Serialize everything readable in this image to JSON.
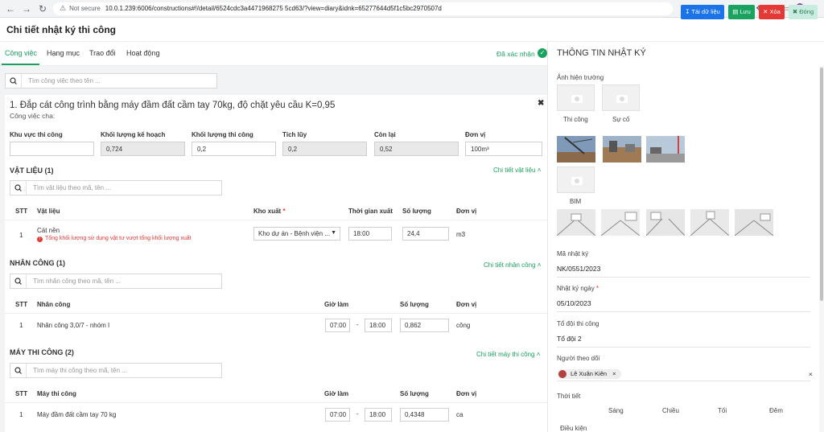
{
  "browser": {
    "not_secure": "Not secure",
    "url": "10.0.1.239:6006/constructions#!/detail/6524cdc3a4471968275 5cd63/?view=diary&idnk=65277644d5f1c5bc2970507d",
    "profile_initial": "A"
  },
  "header": {
    "title": "Chi tiết nhật ký thi công",
    "download": "Tải dữ liệu",
    "save": "Lưu",
    "delete": "Xóa",
    "close": "Đóng"
  },
  "tabs": [
    "Công việc",
    "Hạng mục",
    "Trao đổi",
    "Hoạt động"
  ],
  "confirmed_label": "Đã xác nhận",
  "search_task_placeholder": "Tìm công việc theo tên ...",
  "task": {
    "title": "1. Đắp cát công trình bằng máy đầm đất cầm tay 70kg, độ chặt yêu cầu K=0,95",
    "parent_label": "Công việc cha:",
    "fields": {
      "area": {
        "label": "Khu vực thi công",
        "value": ""
      },
      "planned": {
        "label": "Khối lượng kế hoạch",
        "value": "0,724"
      },
      "done": {
        "label": "Khối lượng thi công",
        "value": "0,2"
      },
      "cumulative": {
        "label": "Tích lũy",
        "value": "0,2"
      },
      "remaining": {
        "label": "Còn lại",
        "value": "0,52"
      },
      "unit": {
        "label": "Đơn vị",
        "value": "100m³"
      }
    }
  },
  "materials": {
    "title": "VẬT LIỆU (1)",
    "link": "Chi tiết vật liệu",
    "search_placeholder": "Tìm vật liệu theo mã, tên ...",
    "headers": {
      "stt": "STT",
      "name": "Vật liệu",
      "warehouse": "Kho xuất",
      "time": "Thời gian xuất",
      "qty": "Số lượng",
      "unit": "Đơn vị"
    },
    "rows": [
      {
        "stt": "1",
        "name": "Cát nền",
        "error": "Tổng khối lượng sử dụng vật tư vượt tổng khối lượng xuất",
        "warehouse": "Kho dự án - Bệnh viện ...",
        "time": "18:00",
        "qty": "24,4",
        "unit": "m3"
      }
    ]
  },
  "labor": {
    "title": "NHÂN CÔNG (1)",
    "link": "Chi tiết nhân công",
    "search_placeholder": "Tìm nhân công theo mã, tên ...",
    "headers": {
      "stt": "STT",
      "name": "Nhân công",
      "hours": "Giờ làm",
      "qty": "Số lượng",
      "unit": "Đơn vị"
    },
    "rows": [
      {
        "stt": "1",
        "name": "Nhân công 3,0/7 - nhóm I",
        "from": "07:00",
        "to": "18:00",
        "qty": "0,862",
        "unit": "công"
      }
    ]
  },
  "machines": {
    "title": "MÁY THI CÔNG (2)",
    "link": "Chi tiết máy thi công",
    "search_placeholder": "Tìm máy thi công theo mã, tên ...",
    "headers": {
      "stt": "STT",
      "name": "Máy thi công",
      "hours": "Giờ làm",
      "qty": "Số lượng",
      "unit": "Đơn vị"
    },
    "rows": [
      {
        "stt": "1",
        "name": "Máy đầm đất cầm tay 70 kg",
        "from": "07:00",
        "to": "18:00",
        "qty": "0,4348",
        "unit": "ca"
      }
    ]
  },
  "right_panel": {
    "title": "THÔNG TIN NHẬT KÝ",
    "site_photos": "Ảnh hiện trường",
    "construction": "Thi công",
    "incident": "Sự cố",
    "bim": "BIM",
    "code_label": "Mã nhật ký",
    "code_value": "NK/0551/2023",
    "date_label": "Nhật ký ngày",
    "date_value": "05/10/2023",
    "team_label": "Tổ đội thi công",
    "team_value": "Tổ đội 2",
    "follower_label": "Người theo dõi",
    "follower": "Lê Xuân Kiên",
    "weather_label": "Thời tiết",
    "weather_cols": [
      "Sáng",
      "Chiều",
      "Tối",
      "Đêm"
    ],
    "condition_label": "Điều kiện"
  },
  "colors": {
    "accent": "#1aa260",
    "primary": "#1a73e8",
    "danger": "#e53935"
  }
}
